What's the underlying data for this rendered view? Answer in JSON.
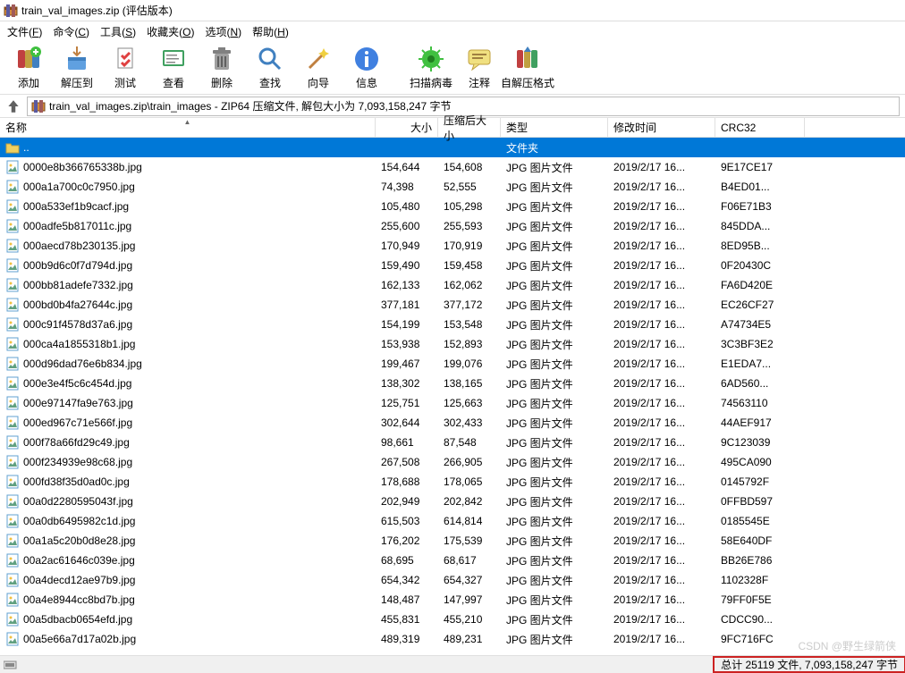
{
  "title": "train_val_images.zip (评估版本)",
  "menu": [
    {
      "label": "文件",
      "key": "F"
    },
    {
      "label": "命令",
      "key": "C"
    },
    {
      "label": "工具",
      "key": "S"
    },
    {
      "label": "收藏夹",
      "key": "O"
    },
    {
      "label": "选项",
      "key": "N"
    },
    {
      "label": "帮助",
      "key": "H"
    }
  ],
  "toolbar": {
    "add": "添加",
    "extract": "解压到",
    "test": "测试",
    "view": "查看",
    "delete": "删除",
    "find": "查找",
    "wizard": "向导",
    "info": "信息",
    "virus": "扫描病毒",
    "comment": "注释",
    "sfx": "自解压格式"
  },
  "location": "train_val_images.zip\\train_images - ZIP64 压缩文件, 解包大小为 7,093,158,247 字节",
  "columns": {
    "name": "名称",
    "size": "大小",
    "packed": "压缩后大小",
    "type": "类型",
    "date": "修改时间",
    "crc": "CRC32"
  },
  "folder_type": "文件夹",
  "jpg_type": "JPG 图片文件",
  "common_date": "2019/2/17 16...",
  "parent_dir": "..",
  "files": [
    {
      "name": "0000e8b366765338b.jpg",
      "size": "154,644",
      "packed": "154,608",
      "crc": "9E17CE17"
    },
    {
      "name": "000a1a700c0c7950.jpg",
      "size": "74,398",
      "packed": "52,555",
      "crc": "B4ED01..."
    },
    {
      "name": "000a533ef1b9cacf.jpg",
      "size": "105,480",
      "packed": "105,298",
      "crc": "F06E71B3"
    },
    {
      "name": "000adfe5b817011c.jpg",
      "size": "255,600",
      "packed": "255,593",
      "crc": "845DDA..."
    },
    {
      "name": "000aecd78b230135.jpg",
      "size": "170,949",
      "packed": "170,919",
      "crc": "8ED95B..."
    },
    {
      "name": "000b9d6c0f7d794d.jpg",
      "size": "159,490",
      "packed": "159,458",
      "crc": "0F20430C"
    },
    {
      "name": "000bb81adefe7332.jpg",
      "size": "162,133",
      "packed": "162,062",
      "crc": "FA6D420E"
    },
    {
      "name": "000bd0b4fa27644c.jpg",
      "size": "377,181",
      "packed": "377,172",
      "crc": "EC26CF27"
    },
    {
      "name": "000c91f4578d37a6.jpg",
      "size": "154,199",
      "packed": "153,548",
      "crc": "A74734E5"
    },
    {
      "name": "000ca4a1855318b1.jpg",
      "size": "153,938",
      "packed": "152,893",
      "crc": "3C3BF3E2"
    },
    {
      "name": "000d96dad76e6b834.jpg",
      "size": "199,467",
      "packed": "199,076",
      "crc": "E1EDA7..."
    },
    {
      "name": "000e3e4f5c6c454d.jpg",
      "size": "138,302",
      "packed": "138,165",
      "crc": "6AD560..."
    },
    {
      "name": "000e97147fa9e763.jpg",
      "size": "125,751",
      "packed": "125,663",
      "crc": "74563110"
    },
    {
      "name": "000ed967c71e566f.jpg",
      "size": "302,644",
      "packed": "302,433",
      "crc": "44AEF917"
    },
    {
      "name": "000f78a66fd29c49.jpg",
      "size": "98,661",
      "packed": "87,548",
      "crc": "9C123039"
    },
    {
      "name": "000f234939e98c68.jpg",
      "size": "267,508",
      "packed": "266,905",
      "crc": "495CA090"
    },
    {
      "name": "000fd38f35d0ad0c.jpg",
      "size": "178,688",
      "packed": "178,065",
      "crc": "0145792F"
    },
    {
      "name": "00a0d2280595043f.jpg",
      "size": "202,949",
      "packed": "202,842",
      "crc": "0FFBD597"
    },
    {
      "name": "00a0db6495982c1d.jpg",
      "size": "615,503",
      "packed": "614,814",
      "crc": "0185545E"
    },
    {
      "name": "00a1a5c20b0d8e28.jpg",
      "size": "176,202",
      "packed": "175,539",
      "crc": "58E640DF"
    },
    {
      "name": "00a2ac61646c039e.jpg",
      "size": "68,695",
      "packed": "68,617",
      "crc": "BB26E786"
    },
    {
      "name": "00a4decd12ae97b9.jpg",
      "size": "654,342",
      "packed": "654,327",
      "crc": "1102328F"
    },
    {
      "name": "00a4e8944cc8bd7b.jpg",
      "size": "148,487",
      "packed": "147,997",
      "crc": "79FF0F5E"
    },
    {
      "name": "00a5dbacb0654efd.jpg",
      "size": "455,831",
      "packed": "455,210",
      "crc": "CDCC90..."
    },
    {
      "name": "00a5e66a7d17a02b.jpg",
      "size": "489,319",
      "packed": "489,231",
      "crc": "9FC716FC"
    }
  ],
  "status": "总计 25119 文件, 7,093,158,247 字节",
  "watermark": "CSDN @野生绿箭侠"
}
